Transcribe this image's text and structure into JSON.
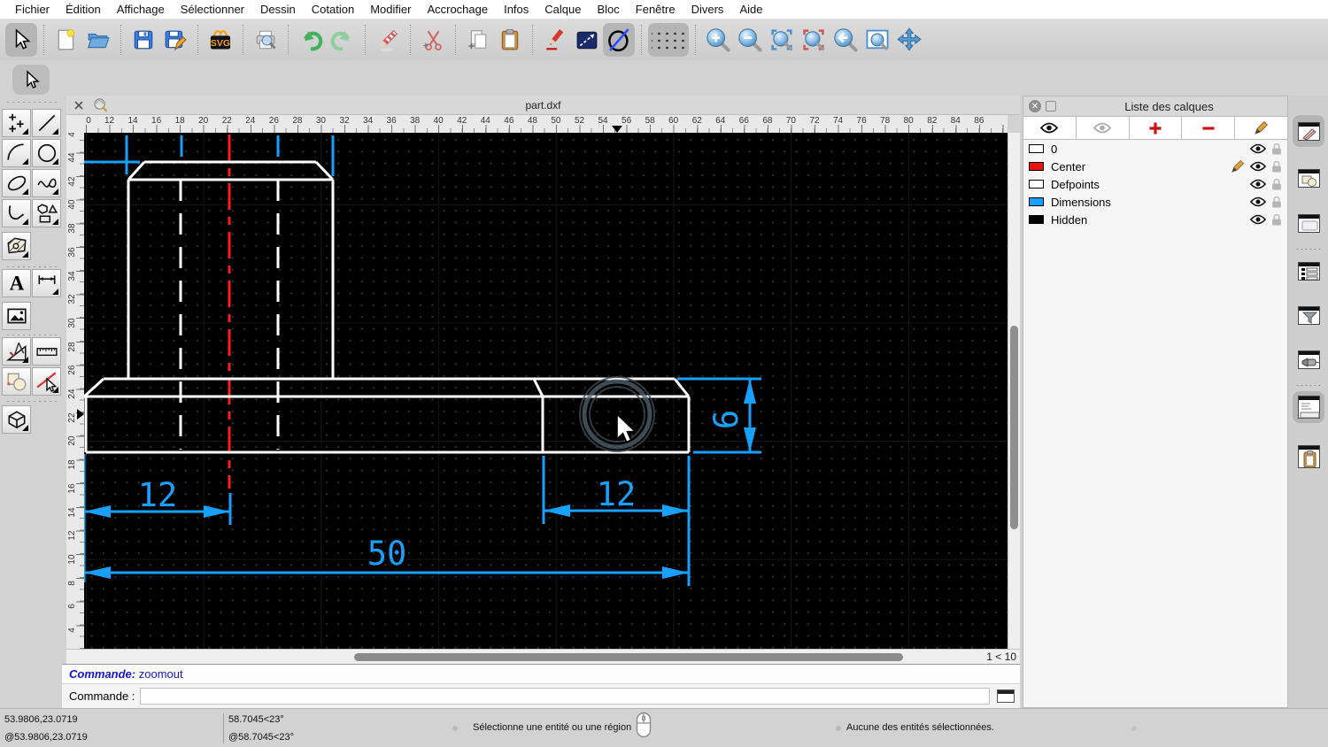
{
  "menu": {
    "items": [
      "Fichier",
      "Édition",
      "Affichage",
      "Sélectionner",
      "Dessin",
      "Cotation",
      "Modifier",
      "Accrochage",
      "Infos",
      "Calque",
      "Bloc",
      "Fenêtre",
      "Divers",
      "Aide"
    ]
  },
  "toolbar": {
    "svg_badge": "SVG",
    "buttons": [
      "select",
      "new-file",
      "open-file",
      "save",
      "save-as",
      "svg-export",
      "print-preview",
      "undo",
      "redo",
      "delete",
      "cut",
      "copy",
      "paste",
      "pen-edit",
      "line-attributes",
      "circle-attributes",
      "grid-toggle",
      "zoom-in",
      "zoom-out",
      "zoom-auto",
      "zoom-previous",
      "zoom-back",
      "zoom-window",
      "zoom-pan"
    ]
  },
  "left_palette": {
    "tools": [
      "points",
      "line",
      "arc",
      "circle",
      "ellipse",
      "spline",
      "polyline",
      "polygon",
      "hatch",
      "text",
      "dimension",
      "image",
      "measure",
      "ruler",
      "order",
      "select-entity",
      "solid"
    ],
    "text_tool_glyph": "A"
  },
  "document_tab": {
    "title": "part.dxf"
  },
  "rulers": {
    "top_labels": [
      "0",
      "12",
      "14",
      "16",
      "18",
      "20",
      "22",
      "24",
      "26",
      "28",
      "30",
      "32",
      "34",
      "36",
      "38",
      "40",
      "42",
      "44",
      "46",
      "48",
      "50",
      "52",
      "54",
      "56",
      "58",
      "60",
      "62",
      "64",
      "66",
      "68",
      "70",
      "72",
      "74",
      "76",
      "78",
      "80",
      "82",
      "84",
      "86"
    ],
    "left_labels": [
      "4",
      "44",
      "42",
      "40",
      "38",
      "36",
      "34",
      "32",
      "30",
      "28",
      "26",
      "24",
      "22",
      "20",
      "18",
      "16",
      "14",
      "12",
      "10",
      "8",
      "6",
      "4"
    ]
  },
  "canvas": {
    "zoom_scale": "1 < 10",
    "dimensions": {
      "left_offset": "12",
      "right_offset": "12",
      "total_length": "50",
      "thickness": "6"
    },
    "colors": {
      "outline": "#ffffff",
      "hidden_line": "#ffffff",
      "center_line": "#ff1c1c",
      "dimension": "#18a0ff",
      "background": "#000000"
    }
  },
  "command_console": {
    "history_label": "Commande:",
    "history_value": "zoomout",
    "prompt_label": "Commande :"
  },
  "layers_panel": {
    "title": "Liste des calques",
    "layers": [
      {
        "name": "0",
        "color": "#ffffff",
        "current": false
      },
      {
        "name": "Center",
        "color": "#ee1111",
        "current": true
      },
      {
        "name": "Defpoints",
        "color": "#ffffff",
        "current": false
      },
      {
        "name": "Dimensions",
        "color": "#18a0ff",
        "current": false
      },
      {
        "name": "Hidden",
        "color": "#000000",
        "current": false
      }
    ]
  },
  "status_bar": {
    "coords_abs": "53.9806,23.0719",
    "coords_rel": "@53.9806,23.0719",
    "polar_abs": "58.7045<23°",
    "polar_rel": "@58.7045<23°",
    "hint": "Sélectionne une entité ou une région",
    "selection_info": "Aucune des entités sélectionnées."
  }
}
